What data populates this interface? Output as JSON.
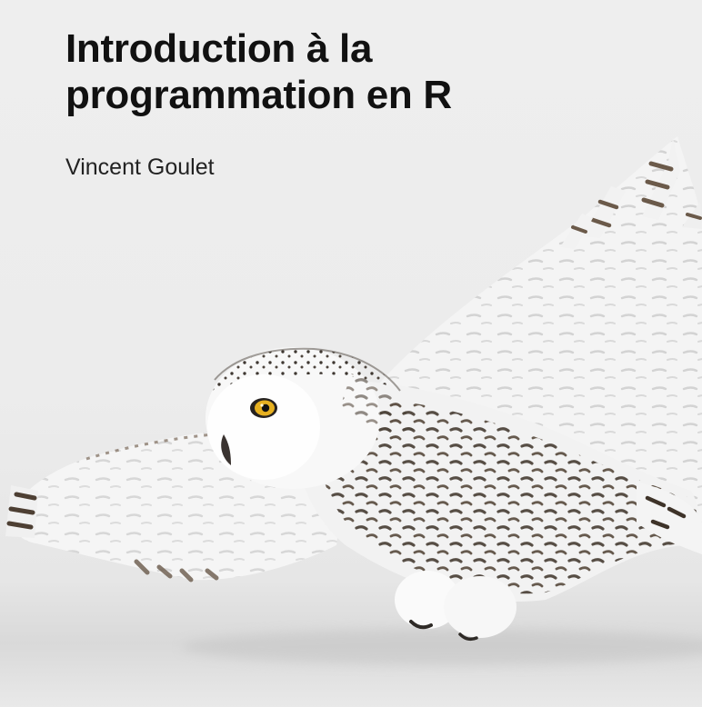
{
  "cover": {
    "title_line1": "Introduction à la",
    "title_line2": "programmation en R",
    "author": "Vincent Goulet"
  },
  "illustration": {
    "subject": "snowy-owl",
    "colors": {
      "background": "#ececec",
      "plumage": "#f7f7f7",
      "barring": "#4a4036",
      "eye": "#e6b020"
    }
  }
}
